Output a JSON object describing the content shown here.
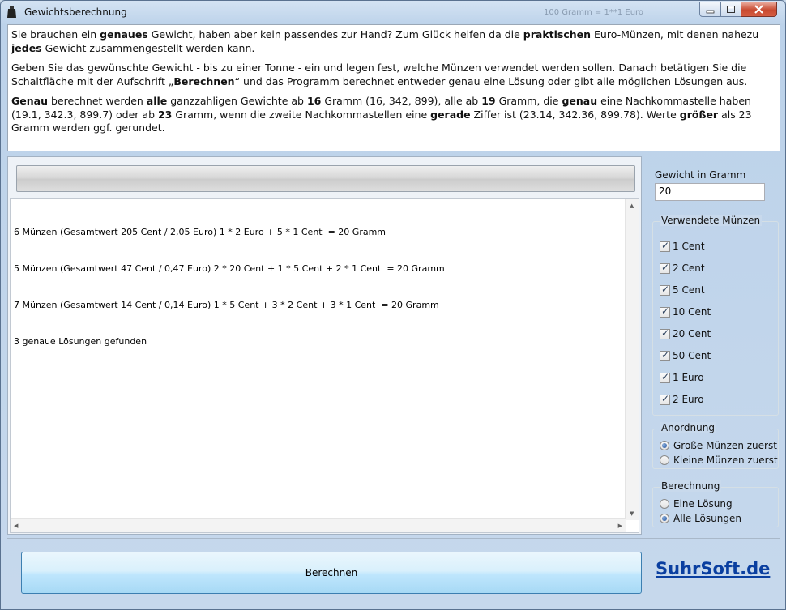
{
  "window": {
    "title": "Gewichtsberechnung",
    "title_ghost": "100 Gramm = 1**1 Euro",
    "controls": {
      "minimize": "minimize",
      "maximize": "maximize",
      "close": "close"
    }
  },
  "info": {
    "p1": [
      {
        "t": "Sie brauchen ein ",
        "b": false
      },
      {
        "t": "genaues",
        "b": true
      },
      {
        "t": " Gewicht, haben aber kein passendes zur Hand? Zum Glück helfen da die ",
        "b": false
      },
      {
        "t": "praktischen",
        "b": true
      },
      {
        "t": " Euro-Münzen, mit denen nahezu ",
        "b": false
      },
      {
        "t": "jedes",
        "b": true
      },
      {
        "t": " Gewicht zusammengestellt werden kann.",
        "b": false
      }
    ],
    "p2": [
      {
        "t": "Geben Sie das gewünschte Gewicht - bis zu einer Tonne - ein und legen fest, welche Münzen verwendet werden sollen. Danach betätigen Sie die Schaltfläche mit der Aufschrift „",
        "b": false
      },
      {
        "t": "Berechnen",
        "b": true
      },
      {
        "t": "“ und das Programm berechnet entweder genau eine Lösung oder gibt alle möglichen Lösungen aus.",
        "b": false
      }
    ],
    "p3": [
      {
        "t": "Genau",
        "b": true
      },
      {
        "t": " berechnet werden ",
        "b": false
      },
      {
        "t": "alle",
        "b": true
      },
      {
        "t": " ganzzahligen Gewichte ab ",
        "b": false
      },
      {
        "t": "16",
        "b": true
      },
      {
        "t": " Gramm (16, 342, 899), alle ab ",
        "b": false
      },
      {
        "t": "19",
        "b": true
      },
      {
        "t": " Gramm, die ",
        "b": false
      },
      {
        "t": "genau",
        "b": true
      },
      {
        "t": " eine Nachkommastelle haben (19.1, 342.3, 899.7) oder ab ",
        "b": false
      },
      {
        "t": "23",
        "b": true
      },
      {
        "t": " Gramm, wenn die zweite Nachkommastellen eine ",
        "b": false
      },
      {
        "t": "gerade",
        "b": true
      },
      {
        "t": " Ziffer ist (23.14, 342.36, 899.78). Werte ",
        "b": false
      },
      {
        "t": "größer",
        "b": true
      },
      {
        "t": " als 23 Gramm werden ggf. gerundet.",
        "b": false
      }
    ]
  },
  "results": {
    "lines": [
      "6 Münzen (Gesamtwert 205 Cent / 2,05 Euro) 1 * 2 Euro + 5 * 1 Cent  = 20 Gramm",
      "5 Münzen (Gesamtwert 47 Cent / 0,47 Euro) 2 * 20 Cent + 1 * 5 Cent + 2 * 1 Cent  = 20 Gramm",
      "7 Münzen (Gesamtwert 14 Cent / 0,14 Euro) 1 * 5 Cent + 3 * 2 Cent + 3 * 1 Cent  = 20 Gramm",
      "3 genaue Lösungen gefunden"
    ],
    "progress": 0
  },
  "weight": {
    "label": "Gewicht in Gramm",
    "value": "20"
  },
  "coins": {
    "title": "Verwendete Münzen",
    "items": [
      {
        "label": "1 Cent",
        "checked": true
      },
      {
        "label": "2 Cent",
        "checked": true
      },
      {
        "label": "5 Cent",
        "checked": true
      },
      {
        "label": "10 Cent",
        "checked": true
      },
      {
        "label": "20 Cent",
        "checked": true
      },
      {
        "label": "50 Cent",
        "checked": true
      },
      {
        "label": "1 Euro",
        "checked": true
      },
      {
        "label": "2 Euro",
        "checked": true
      }
    ]
  },
  "order": {
    "title": "Anordnung",
    "options": [
      {
        "label": "Große Münzen zuerst",
        "selected": true
      },
      {
        "label": "Kleine Münzen zuerst",
        "selected": false
      }
    ]
  },
  "calculation": {
    "title": "Berechnung",
    "options": [
      {
        "label": "Eine Lösung",
        "selected": false
      },
      {
        "label": "Alle Lösungen",
        "selected": true
      }
    ]
  },
  "actions": {
    "calculate": "Berechnen"
  },
  "brand": {
    "text": "SuhrSoft.de"
  }
}
